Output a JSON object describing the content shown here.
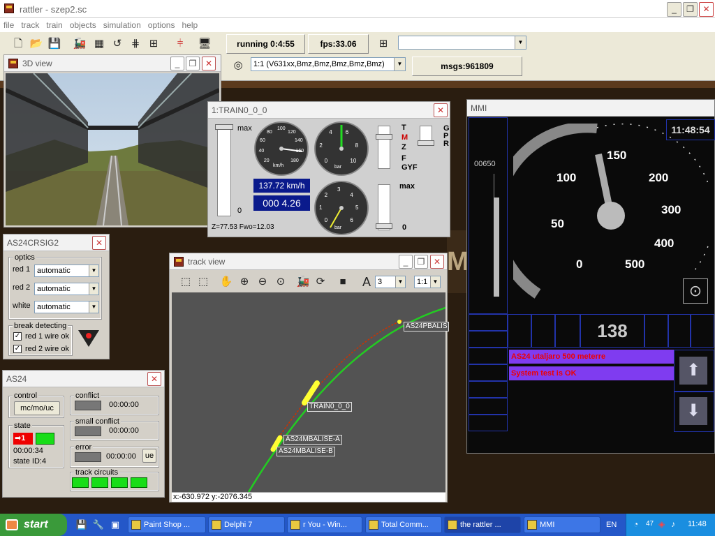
{
  "app": {
    "title": "rattler - szep2.sc",
    "menu": [
      "file",
      "track",
      "train",
      "objects",
      "simulation",
      "options",
      "help"
    ]
  },
  "toolbar": {
    "running": "running 0:4:55",
    "fps": "fps:33.06",
    "msgs": "msgs:961809",
    "train_select": "1:1 (V631xx,Bmz,Bmz,Bmz,Bmz,Bmz)",
    "empty_combo": ""
  },
  "view3d": {
    "title": "3D view"
  },
  "train": {
    "title": "1:TRAIN0_0_0",
    "slider_max": "max",
    "slider_zero": "0",
    "speed": "137.72 km/h",
    "distance": "000 4.26",
    "footer": "Z=77.53 Fwo=12.03",
    "gauge_speed_unit": "km/h",
    "gauge_bar_unit": "bar",
    "gauge_ticks_speed": [
      "20",
      "40",
      "60",
      "80",
      "100",
      "120",
      "140",
      "160",
      "180"
    ],
    "gauge_ticks_bar1": [
      "0",
      "2",
      "4",
      "6",
      "8",
      "10"
    ],
    "gauge_ticks_bar2": [
      "0",
      "1",
      "2",
      "3",
      "4",
      "5",
      "6"
    ],
    "brake_letters": [
      "T",
      "M",
      "Z",
      "F",
      "GYF"
    ],
    "gpr": [
      "G",
      "P",
      "R"
    ],
    "right_max": "max",
    "right_zero": "0"
  },
  "sig": {
    "title": "AS24CRSIG2",
    "optics_label": "optics",
    "rows": [
      {
        "label": "red 1",
        "value": "automatic"
      },
      {
        "label": "red 2",
        "value": "automatic"
      },
      {
        "label": "white",
        "value": "automatic"
      }
    ],
    "break_label": "break detecting",
    "checks": [
      {
        "label": "red 1 wire ok",
        "checked": true
      },
      {
        "label": "red 2 wire ok",
        "checked": true
      }
    ]
  },
  "as24": {
    "title": "AS24",
    "control_label": "control",
    "control_button": "mc/mo/uc",
    "state_label": "state",
    "state_arrow": "1",
    "state_time": "00:00:34",
    "state_id": "state ID:4",
    "conflict_label": "conflict",
    "conflict_time": "00:00:00",
    "small_conflict_label": "small conflict",
    "small_conflict_time": "00:00:00",
    "error_label": "error",
    "error_time": "00:00:00",
    "ue_button": "ue",
    "track_circuits_label": "track circuits"
  },
  "trackview": {
    "title": "track view",
    "font_combo": "3",
    "scale_combo": "1:1",
    "labels": {
      "pbalise": "AS24PBALIS",
      "train": "TRAIN0_0_0",
      "mbalise_a": "AS24MBALISE-A",
      "mbalise_b": "AS24MBALISE-B"
    },
    "coords": "x:-630.972 y:-2076.345"
  },
  "mmi": {
    "title": "MMI",
    "clock": "11:48:54",
    "distance": "00650",
    "speed": "138",
    "scale": [
      "0",
      "50",
      "100",
      "150",
      "200",
      "300",
      "400",
      "500"
    ],
    "messages": [
      "AS24 utaljaro 500 meterre",
      "System test is OK"
    ]
  },
  "taskbar": {
    "start": "start",
    "tasks": [
      "Paint Shop ...",
      "Delphi 7",
      "r You - Win...",
      "Total Comm...",
      "the rattler ...",
      "MMI"
    ],
    "lang": "EN",
    "tray_num": "47",
    "clock": "11:48"
  },
  "colors": {
    "mmi_message_bg": "#7f3cf0",
    "mmi_message_text": "#e00000",
    "track_green": "#22cc22",
    "track_red": "#cc3300",
    "balise_yellow": "#ffff33",
    "lcd_blue": "#0a1a8c"
  }
}
